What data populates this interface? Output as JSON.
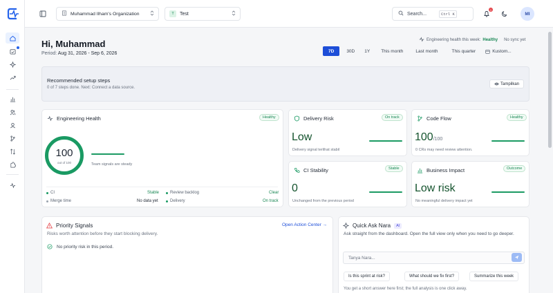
{
  "sidebar": {
    "logo": "nara-logo",
    "items": [
      {
        "icon": "home-icon",
        "active": true
      },
      {
        "icon": "calendar-check-icon",
        "active": false,
        "dot": true
      },
      {
        "icon": "sparkles-icon",
        "active": false
      },
      {
        "icon": "trend-up-icon",
        "active": false
      },
      {
        "icon": "bar-chart-icon",
        "active": false
      },
      {
        "icon": "users-icon",
        "active": false
      },
      {
        "icon": "team-icon",
        "active": false
      },
      {
        "icon": "git-branch-icon",
        "active": false
      },
      {
        "icon": "git-compare-icon",
        "active": false
      },
      {
        "icon": "puzzle-icon",
        "active": false
      },
      {
        "icon": "activity-icon",
        "active": false
      }
    ]
  },
  "topbar": {
    "org": "Muhammad Ilham's Organization",
    "project_badge": "T",
    "project": "Test",
    "search_placeholder": "Search...",
    "search_shortcut": "Ctrl K",
    "notification_count": "1",
    "avatar": "MI"
  },
  "header": {
    "greeting": "Hi, Muhammad",
    "period_label": "Period:",
    "period_value": "Aug 31, 2026 - Sep 6, 2026",
    "health_label": "Engineering health this week:",
    "health_value": "Healthy",
    "sync_status": "No sync yet",
    "ranges": [
      "7D",
      "30D",
      "1Y",
      "This month",
      "Last month",
      "This quarter",
      "Kustom..."
    ]
  },
  "setup": {
    "title": "Recommended setup steps",
    "subtitle": "0 of 7 steps done. Next: Connect a data source.",
    "button": "Tampilkan"
  },
  "engineering_health": {
    "title": "Engineering Health",
    "badge": "Healthy",
    "score": "100",
    "score_caption": "out of 100",
    "note": "Team signals are steady",
    "stats": [
      {
        "label": "CI",
        "value": "Stable"
      },
      {
        "label": "Review backlog",
        "value": "Clear"
      },
      {
        "label": "Merge time",
        "value": "No data yet"
      },
      {
        "label": "Delivery",
        "value": "On track"
      }
    ]
  },
  "delivery_risk": {
    "title": "Delivery Risk",
    "badge": "On track",
    "value": "Low",
    "sub": "Delivery signal terlihat stabil"
  },
  "code_flow": {
    "title": "Code Flow",
    "badge": "Healthy",
    "value": "100",
    "value_suffix": "/100",
    "sub": "0 CRs may need review attention."
  },
  "ci_stability": {
    "title": "CI Stability",
    "badge": "Stable",
    "value": "0",
    "sub": "Unchanged from the previous period"
  },
  "business_impact": {
    "title": "Business Impact",
    "badge": "Outcome",
    "value": "Low risk",
    "sub": "No meaningful delivery impact yet"
  },
  "priority_signals": {
    "title": "Priority Signals",
    "link": "Open Action Center →",
    "subtitle": "Risks worth attention before they start blocking delivery.",
    "empty": "No priority risk in this period."
  },
  "quick_ask": {
    "title": "Quick Ask Nara",
    "tag": "AI",
    "description": "Ask straight from the dashboard. Open the full view only when you need to go deeper.",
    "placeholder": "Tanya Nara...",
    "chips": [
      "Is this sprint at risk?",
      "What should we fix first?",
      "Summarize this week"
    ],
    "footer": "You get a short answer here first; the full analysis is one click away."
  },
  "colors": {
    "accent": "#1d4ed8",
    "healthy": "#1a9a63",
    "alert": "#e5484d"
  }
}
